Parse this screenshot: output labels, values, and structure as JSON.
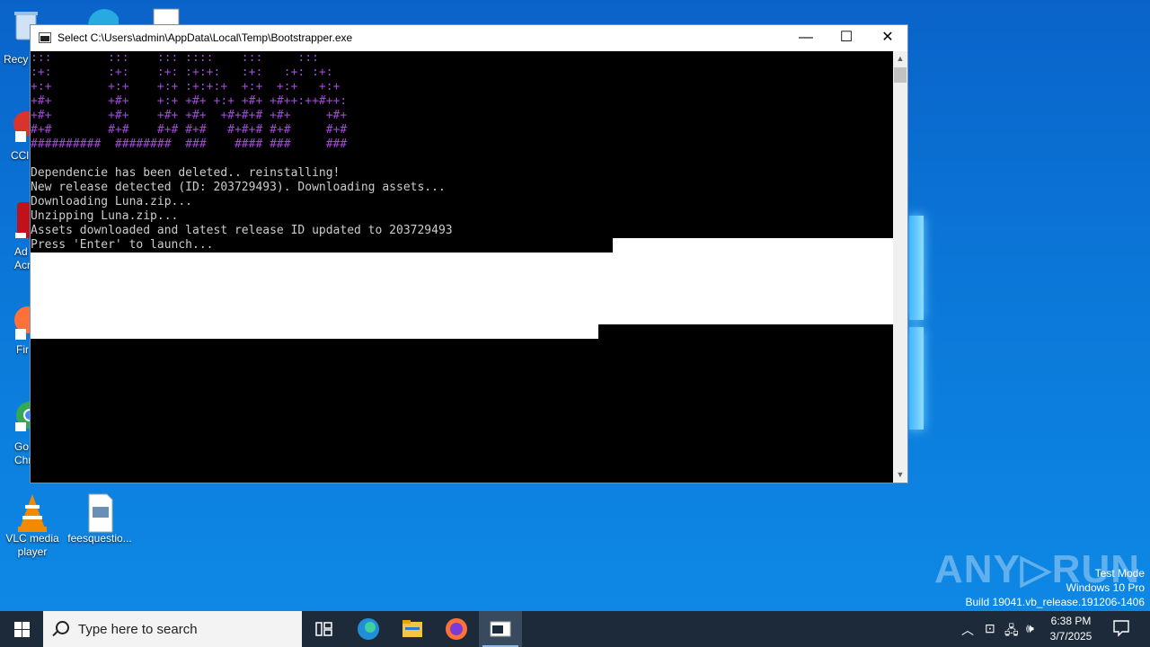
{
  "desktop": {
    "icons": [
      {
        "label": "Recy"
      },
      {
        "label": "CCl"
      },
      {
        "label": "Ad\nAcr"
      },
      {
        "label": "Fir"
      },
      {
        "label": "Go\nChr"
      },
      {
        "label": "VLC media\nplayer"
      },
      {
        "label": "feesquestio..."
      }
    ]
  },
  "console_window": {
    "title": "Select C:\\Users\\admin\\AppData\\Local\\Temp\\Bootstrapper.exe",
    "minimize_glyph": "—",
    "maximize_glyph": "☐",
    "close_glyph": "✕",
    "art_lines": [
      ":::        :::    ::: ::::    :::     :::",
      ":+:        :+:    :+: :+:+:   :+:   :+: :+:",
      "+:+        +:+    +:+ :+:+:+  +:+  +:+   +:+",
      "+#+        +#+    +:+ +#+ +:+ +#+ +#++:++#++:",
      "+#+        +#+    +#+ +#+  +#+#+# +#+     +#+",
      "#+#        #+#    #+# #+#   #+#+# #+#     #+#",
      "##########  ########  ###    #### ###     ###"
    ],
    "output_lines": [
      "Dependencie has been deleted.. reinstalling!",
      "New release detected (ID: 203729493). Downloading assets...",
      "Downloading Luna.zip...",
      "Unzipping Luna.zip...",
      "Assets downloaded and latest release ID updated to 203729493",
      "Press 'Enter' to launch..."
    ]
  },
  "watermark": {
    "text": "ANY▷RUN"
  },
  "system_info": {
    "line1": "Test Mode",
    "line2": "Windows 10 Pro",
    "line3": "Build 19041.vb_release.191206-1406"
  },
  "taskbar": {
    "search_placeholder": "Type here to search",
    "time": "6:38 PM",
    "date": "3/7/2025"
  }
}
